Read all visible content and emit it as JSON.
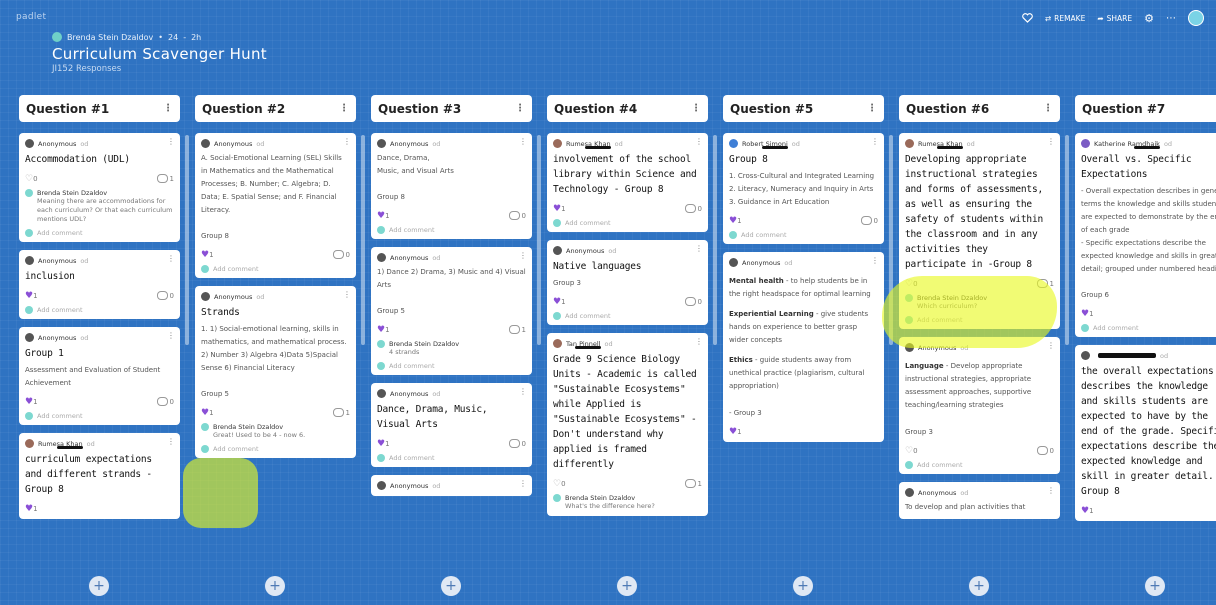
{
  "app": {
    "logo": "padlet"
  },
  "header": {
    "author": "Brenda Stein Dzaldov",
    "post_count": "24",
    "age": "2h",
    "title": "Curriculum Scavenger Hunt",
    "subtitle": "JI152 Responses",
    "actions": {
      "remake": "REMAKE",
      "share": "SHARE"
    }
  },
  "columns": [
    {
      "title": "Question #1",
      "cards": [
        {
          "author": "Anonymous",
          "title": "Accommodation (UDL)",
          "likes": "0",
          "comments": "1",
          "comment_author": "Brenda Stein Dzaldov",
          "comment_text": "Meaning there are accommodations for each curriculum? Or that each curriculum mentions UDL?",
          "add": "Add comment"
        },
        {
          "author": "Anonymous",
          "title": "inclusion",
          "likes": "1",
          "comments": "0",
          "add": "Add comment"
        },
        {
          "author": "Anonymous",
          "title": "Group 1",
          "body": "Assessment and Evaluation of Student Achievement",
          "likes": "1",
          "comments": "0",
          "add": "Add comment"
        },
        {
          "author": "Rumesa Khan",
          "title": "curriculum expectations and different strands - Group 8",
          "likes": "1"
        }
      ]
    },
    {
      "title": "Question #2",
      "cards": [
        {
          "author": "Anonymous",
          "body": "A. Social-Emotional Learning (SEL) Skills in Mathematics and the Mathematical Processes; B. Number; C. Algebra; D. Data; E. Spatial Sense; and F. Financial Literacy.\n\nGroup 8",
          "likes": "1",
          "comments": "0",
          "add": "Add comment"
        },
        {
          "author": "Anonymous",
          "title": "Strands",
          "body": "1. 1) Social-emotional learning, skills in mathematics, and mathematical process. 2) Number 3) Algebra 4)Data 5)Spacial Sense 6) Financial Literacy\n\nGroup 5",
          "likes": "1",
          "comments": "1",
          "comment_author": "Brenda Stein Dzaldov",
          "comment_text": "Great! Used to be 4 - now 6.",
          "add": "Add comment"
        }
      ]
    },
    {
      "title": "Question #3",
      "cards": [
        {
          "author": "Anonymous",
          "body": "Dance, Drama,\nMusic, and Visual Arts\n\nGroup 8",
          "likes": "1",
          "comments": "0",
          "add": "Add comment"
        },
        {
          "author": "Anonymous",
          "body": "1) Dance 2) Drama, 3) Music and 4) Visual Arts\n\nGroup 5",
          "likes": "1",
          "comments": "1",
          "comment_author": "Brenda Stein Dzaldov",
          "comment_text": "4 strands",
          "add": "Add comment"
        },
        {
          "author": "Anonymous",
          "title": "Dance, Drama, Music, Visual Arts",
          "likes": "1",
          "comments": "0",
          "add": "Add comment"
        },
        {
          "author": "Anonymous"
        }
      ]
    },
    {
      "title": "Question #4",
      "cards": [
        {
          "author": "Rumesa Khan",
          "title": "involvement of the school library within Science and Technology - Group 8",
          "likes": "1",
          "comments": "0",
          "add": "Add comment"
        },
        {
          "author": "Anonymous",
          "title": "Native languages",
          "body": "Group 3",
          "likes": "1",
          "comments": "0",
          "add": "Add comment"
        },
        {
          "author": "Tan Pinnell",
          "title": "Grade 9 Science Biology Units - Academic is called \"Sustainable Ecosystems\" while Applied is \"Sustainable Ecosystems\" - Don't understand why applied is framed differently",
          "likes": "0",
          "comments": "1",
          "comment_author": "Brenda Stein Dzaldov",
          "comment_text": "What's the difference here?"
        }
      ]
    },
    {
      "title": "Question #5",
      "cards": [
        {
          "author": "Robert Simoni",
          "title": "Group 8",
          "body": "1. Cross-Cultural and Integrated Learning\n2. Literacy, Numeracy and Inquiry in Arts\n3. Guidance in Art Education",
          "likes": "1",
          "comments": "0",
          "add": "Add comment"
        },
        {
          "author": "Anonymous",
          "sections": [
            {
              "head": "Mental health",
              "text": " - to help students be in the right headspace for optimal learning"
            },
            {
              "head": "Experiential Learning",
              "text": " - give students hands on experience to better grasp wider concepts"
            },
            {
              "head": "Ethics",
              "text": " - guide students away from unethical practice (plagiarism, cultural appropriation)"
            }
          ],
          "tail": "- Group 3",
          "likes": "1"
        }
      ]
    },
    {
      "title": "Question #6",
      "cards": [
        {
          "author": "Rumesa Khan",
          "title": "Developing appropriate instructional strategies and forms of assessments, as well as ensuring the safety of students within the classroom and in any activities they participate in -Group 8",
          "likes": "0",
          "comments": "1",
          "comment_author": "Brenda Stein Dzaldov",
          "comment_text": "Which curriculum?",
          "add": "Add comment"
        },
        {
          "author": "Anonymous",
          "sections": [
            {
              "head": "Language",
              "text": " - Develop appropriate instructional strategies, appropriate assessment approaches, supportive teaching/learning strategies"
            }
          ],
          "tail": "Group 3",
          "likes": "0",
          "comments": "0",
          "add": "Add comment"
        },
        {
          "author": "Anonymous",
          "body": "To develop and plan activities that"
        }
      ]
    },
    {
      "title": "Question #7",
      "cards": [
        {
          "author": "Katherine Ramdhaik",
          "title": "Overall vs. Specific Expectations",
          "body": "- Overall expectation describes in general terms the knowledge and skills students are expected to demonstrate by the end of each grade\n- Specific expectations describe the expected knowledge and skills in greater detail; grouped under numbered headings\n\nGroup 6",
          "likes": "1",
          "add": "Add comment"
        },
        {
          "author": "",
          "title": "the overall expectations describes the knowledge and skills students are expected to have by the end of the grade. Specific expectations describe the expected knowledge and skill in greater detail. - Group 8",
          "likes": "1"
        }
      ]
    }
  ]
}
